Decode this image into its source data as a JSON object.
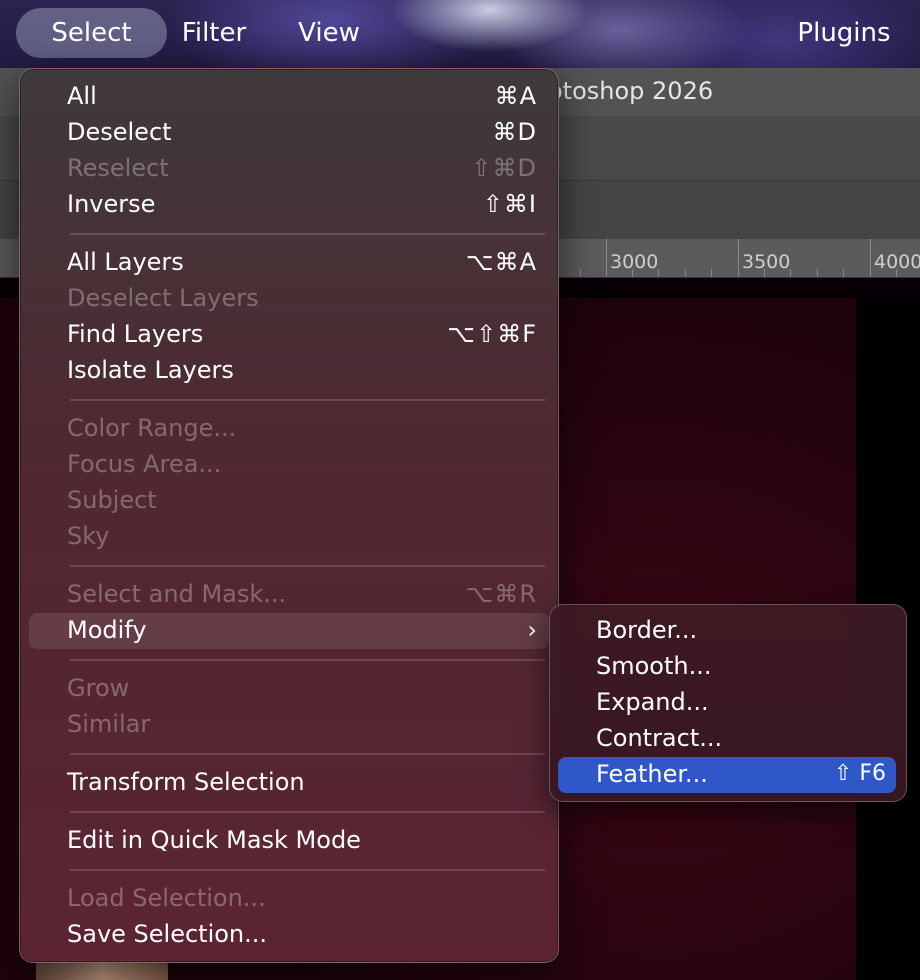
{
  "menubar": {
    "items": [
      "Select",
      "Filter",
      "View",
      "Plugins"
    ]
  },
  "app": {
    "title_fragment": "otoshop 2026",
    "ruler_labels": [
      "3000",
      "3500",
      "4000"
    ]
  },
  "select_menu": {
    "all": {
      "label": "All",
      "shortcut": "⌘A"
    },
    "deselect": {
      "label": "Deselect",
      "shortcut": "⌘D"
    },
    "reselect": {
      "label": "Reselect",
      "shortcut": "⇧⌘D"
    },
    "inverse": {
      "label": "Inverse",
      "shortcut": "⇧⌘I"
    },
    "all_layers": {
      "label": "All Layers",
      "shortcut": "⌥⌘A"
    },
    "deselect_layers": {
      "label": "Deselect Layers"
    },
    "find_layers": {
      "label": "Find Layers",
      "shortcut": "⌥⇧⌘F"
    },
    "isolate_layers": {
      "label": "Isolate Layers"
    },
    "color_range": {
      "label": "Color Range..."
    },
    "focus_area": {
      "label": "Focus Area..."
    },
    "subject": {
      "label": "Subject"
    },
    "sky": {
      "label": "Sky"
    },
    "select_and_mask": {
      "label": "Select and Mask...",
      "shortcut": "⌥⌘R"
    },
    "modify": {
      "label": "Modify",
      "chevron": "›"
    },
    "grow": {
      "label": "Grow"
    },
    "similar": {
      "label": "Similar"
    },
    "transform_selection": {
      "label": "Transform Selection"
    },
    "edit_quick_mask": {
      "label": "Edit in Quick Mask Mode"
    },
    "load_selection": {
      "label": "Load Selection..."
    },
    "save_selection": {
      "label": "Save Selection..."
    }
  },
  "modify_submenu": {
    "border": "Border...",
    "smooth": "Smooth...",
    "expand": "Expand...",
    "contract": "Contract...",
    "feather": {
      "label": "Feather...",
      "shortcut": "⇧ F6"
    }
  },
  "colors": {
    "highlight": "#2f57c7",
    "menu_tint": "#5c2434"
  }
}
